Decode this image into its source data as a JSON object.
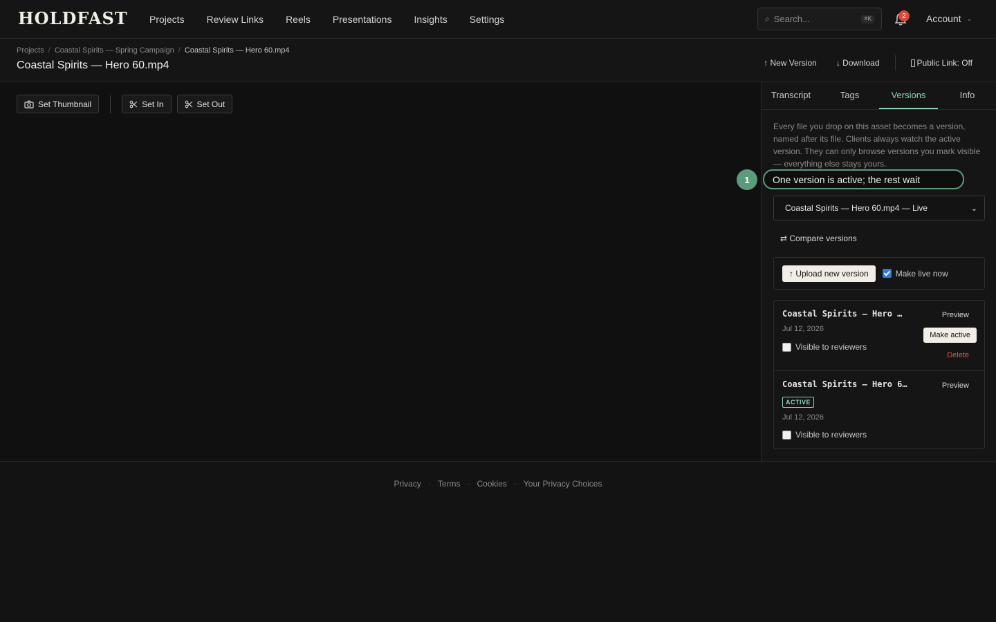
{
  "app": {
    "logo": "HOLDFAST",
    "nav": [
      "Projects",
      "Review Links",
      "Reels",
      "Presentations",
      "Insights",
      "Settings"
    ],
    "search": {
      "placeholder": "Search...",
      "shortcut": "⌘K"
    },
    "notifications_count": "2",
    "account_label": "Account"
  },
  "header": {
    "breadcrumb": [
      "Projects",
      "Coastal Spirits — Spring Campaign",
      "Coastal Spirits — Hero 60.mp4"
    ],
    "title": "Coastal Spirits — Hero 60.mp4",
    "actions": {
      "new_version": "↑ New Version",
      "download": "↓ Download",
      "public_link": "Public Link: Off"
    }
  },
  "toolbar": {
    "set_thumbnail": "Set Thumbnail",
    "set_in": "Set In",
    "set_out": "Set Out"
  },
  "panel": {
    "tabs": [
      "Transcript",
      "Tags",
      "Versions",
      "Info"
    ],
    "active_tab": "Versions",
    "description": "Every file you drop on this asset becomes a version, named after its file. Clients always watch the active version. They can only browse versions you mark visible — everything else stays yours.",
    "select_value": "Coastal Spirits — Hero 60.mp4 — Live",
    "compare_label": "⇄ Compare versions",
    "upload_label": "↑ Upload new version",
    "make_live_label": "Make live now",
    "make_live_checked": true,
    "versions": [
      {
        "name": "Coastal Spirits — Hero …",
        "date": "Jul 12, 2026",
        "visible_label": "Visible to reviewers",
        "preview": "Preview",
        "make_active": "Make active",
        "delete": "Delete"
      },
      {
        "name": "Coastal Spirits — Hero 6…",
        "badge": "ACTIVE",
        "date": "Jul 12, 2026",
        "visible_label": "Visible to reviewers",
        "preview": "Preview"
      }
    ]
  },
  "callout": {
    "number": "1",
    "text": "One version is active; the rest wait"
  },
  "footer": {
    "links": [
      "Privacy",
      "Terms",
      "Cookies",
      "Your Privacy Choices"
    ],
    "separator": "·"
  },
  "colors": {
    "accent": "#8fd4b4",
    "callout": "#5a9b7c",
    "danger": "#e0553f",
    "checkbox": "#2f7bd8"
  }
}
